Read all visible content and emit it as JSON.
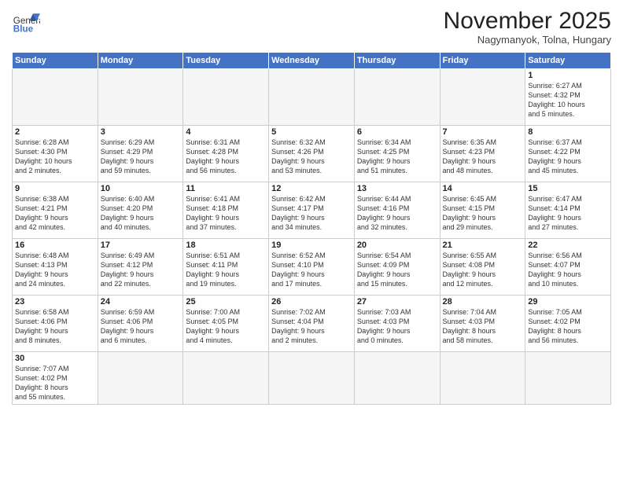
{
  "header": {
    "logo_general": "General",
    "logo_blue": "Blue",
    "month_title": "November 2025",
    "location": "Nagymanyok, Tolna, Hungary"
  },
  "weekdays": [
    "Sunday",
    "Monday",
    "Tuesday",
    "Wednesday",
    "Thursday",
    "Friday",
    "Saturday"
  ],
  "days": [
    {
      "num": "",
      "info": ""
    },
    {
      "num": "",
      "info": ""
    },
    {
      "num": "",
      "info": ""
    },
    {
      "num": "",
      "info": ""
    },
    {
      "num": "",
      "info": ""
    },
    {
      "num": "",
      "info": ""
    },
    {
      "num": "1",
      "info": "Sunrise: 6:27 AM\nSunset: 4:32 PM\nDaylight: 10 hours\nand 5 minutes."
    }
  ],
  "week2": [
    {
      "num": "2",
      "info": "Sunrise: 6:28 AM\nSunset: 4:30 PM\nDaylight: 10 hours\nand 2 minutes."
    },
    {
      "num": "3",
      "info": "Sunrise: 6:29 AM\nSunset: 4:29 PM\nDaylight: 9 hours\nand 59 minutes."
    },
    {
      "num": "4",
      "info": "Sunrise: 6:31 AM\nSunset: 4:28 PM\nDaylight: 9 hours\nand 56 minutes."
    },
    {
      "num": "5",
      "info": "Sunrise: 6:32 AM\nSunset: 4:26 PM\nDaylight: 9 hours\nand 53 minutes."
    },
    {
      "num": "6",
      "info": "Sunrise: 6:34 AM\nSunset: 4:25 PM\nDaylight: 9 hours\nand 51 minutes."
    },
    {
      "num": "7",
      "info": "Sunrise: 6:35 AM\nSunset: 4:23 PM\nDaylight: 9 hours\nand 48 minutes."
    },
    {
      "num": "8",
      "info": "Sunrise: 6:37 AM\nSunset: 4:22 PM\nDaylight: 9 hours\nand 45 minutes."
    }
  ],
  "week3": [
    {
      "num": "9",
      "info": "Sunrise: 6:38 AM\nSunset: 4:21 PM\nDaylight: 9 hours\nand 42 minutes."
    },
    {
      "num": "10",
      "info": "Sunrise: 6:40 AM\nSunset: 4:20 PM\nDaylight: 9 hours\nand 40 minutes."
    },
    {
      "num": "11",
      "info": "Sunrise: 6:41 AM\nSunset: 4:18 PM\nDaylight: 9 hours\nand 37 minutes."
    },
    {
      "num": "12",
      "info": "Sunrise: 6:42 AM\nSunset: 4:17 PM\nDaylight: 9 hours\nand 34 minutes."
    },
    {
      "num": "13",
      "info": "Sunrise: 6:44 AM\nSunset: 4:16 PM\nDaylight: 9 hours\nand 32 minutes."
    },
    {
      "num": "14",
      "info": "Sunrise: 6:45 AM\nSunset: 4:15 PM\nDaylight: 9 hours\nand 29 minutes."
    },
    {
      "num": "15",
      "info": "Sunrise: 6:47 AM\nSunset: 4:14 PM\nDaylight: 9 hours\nand 27 minutes."
    }
  ],
  "week4": [
    {
      "num": "16",
      "info": "Sunrise: 6:48 AM\nSunset: 4:13 PM\nDaylight: 9 hours\nand 24 minutes."
    },
    {
      "num": "17",
      "info": "Sunrise: 6:49 AM\nSunset: 4:12 PM\nDaylight: 9 hours\nand 22 minutes."
    },
    {
      "num": "18",
      "info": "Sunrise: 6:51 AM\nSunset: 4:11 PM\nDaylight: 9 hours\nand 19 minutes."
    },
    {
      "num": "19",
      "info": "Sunrise: 6:52 AM\nSunset: 4:10 PM\nDaylight: 9 hours\nand 17 minutes."
    },
    {
      "num": "20",
      "info": "Sunrise: 6:54 AM\nSunset: 4:09 PM\nDaylight: 9 hours\nand 15 minutes."
    },
    {
      "num": "21",
      "info": "Sunrise: 6:55 AM\nSunset: 4:08 PM\nDaylight: 9 hours\nand 12 minutes."
    },
    {
      "num": "22",
      "info": "Sunrise: 6:56 AM\nSunset: 4:07 PM\nDaylight: 9 hours\nand 10 minutes."
    }
  ],
  "week5": [
    {
      "num": "23",
      "info": "Sunrise: 6:58 AM\nSunset: 4:06 PM\nDaylight: 9 hours\nand 8 minutes."
    },
    {
      "num": "24",
      "info": "Sunrise: 6:59 AM\nSunset: 4:06 PM\nDaylight: 9 hours\nand 6 minutes."
    },
    {
      "num": "25",
      "info": "Sunrise: 7:00 AM\nSunset: 4:05 PM\nDaylight: 9 hours\nand 4 minutes."
    },
    {
      "num": "26",
      "info": "Sunrise: 7:02 AM\nSunset: 4:04 PM\nDaylight: 9 hours\nand 2 minutes."
    },
    {
      "num": "27",
      "info": "Sunrise: 7:03 AM\nSunset: 4:03 PM\nDaylight: 9 hours\nand 0 minutes."
    },
    {
      "num": "28",
      "info": "Sunrise: 7:04 AM\nSunset: 4:03 PM\nDaylight: 8 hours\nand 58 minutes."
    },
    {
      "num": "29",
      "info": "Sunrise: 7:05 AM\nSunset: 4:02 PM\nDaylight: 8 hours\nand 56 minutes."
    }
  ],
  "week6": [
    {
      "num": "30",
      "info": "Sunrise: 7:07 AM\nSunset: 4:02 PM\nDaylight: 8 hours\nand 55 minutes."
    },
    {
      "num": "",
      "info": ""
    },
    {
      "num": "",
      "info": ""
    },
    {
      "num": "",
      "info": ""
    },
    {
      "num": "",
      "info": ""
    },
    {
      "num": "",
      "info": ""
    },
    {
      "num": "",
      "info": ""
    }
  ]
}
